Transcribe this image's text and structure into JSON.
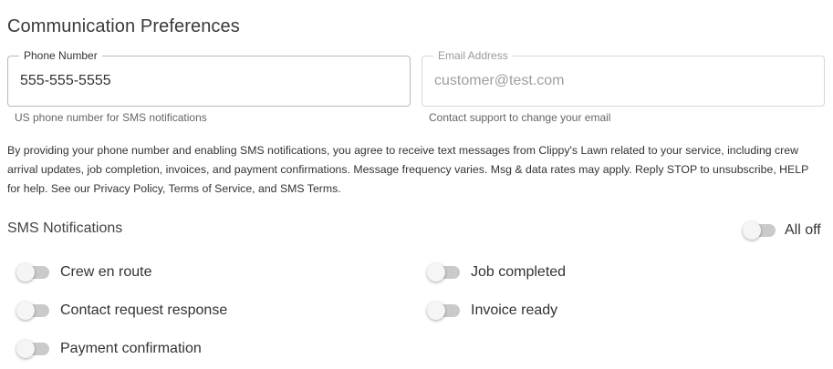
{
  "title": "Communication Preferences",
  "phone_field": {
    "label": "Phone Number",
    "value": "555-555-5555",
    "helper": "US phone number for SMS notifications"
  },
  "email_field": {
    "label": "Email Address",
    "value": "customer@test.com",
    "helper": "Contact support to change your email"
  },
  "consent": {
    "text": "By providing your phone number and enabling SMS notifications, you agree to receive text messages from Clippy's Lawn related to your service, including crew arrival updates, job completion, invoices, and payment confirmations. Message frequency varies. Msg & data rates may apply. Reply STOP to unsubscribe, HELP for help. See our ",
    "privacy_link": "Privacy Policy",
    "sep1": ", ",
    "terms_link": "Terms of Service",
    "sep2": ", and ",
    "sms_terms_link": "SMS Terms",
    "end": "."
  },
  "sms": {
    "label": "SMS Notifications",
    "all_toggle": {
      "label": "All off",
      "on": false
    },
    "toggles": [
      {
        "label": "Crew en route",
        "on": false
      },
      {
        "label": "Job completed",
        "on": false
      },
      {
        "label": "Contact request response",
        "on": false
      },
      {
        "label": "Invoice ready",
        "on": false
      },
      {
        "label": "Payment confirmation",
        "on": false
      }
    ]
  }
}
